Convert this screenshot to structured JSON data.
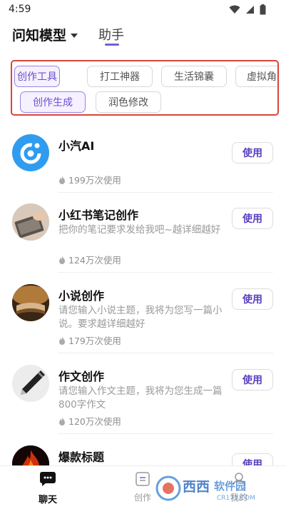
{
  "status_bar": {
    "time": "4:59"
  },
  "header": {
    "model_title": "问知模型",
    "tab_assistant": "助手"
  },
  "categories": {
    "row1": [
      "创作工具",
      "打工神器",
      "生活锦囊",
      "虚拟角"
    ],
    "row2": [
      "创作生成",
      "润色修改"
    ]
  },
  "items": [
    {
      "title": "小汽AI",
      "desc": "",
      "usage": "199万次使用",
      "button": "使用"
    },
    {
      "title": "小红书笔记创作",
      "desc": "把你的笔记要求发给我吧~越详细越好",
      "usage": "124万次使用",
      "button": "使用"
    },
    {
      "title": "小说创作",
      "desc": "请您输入小说主题，我将为您写一篇小说。要求越详细越好",
      "usage": "179万次使用",
      "button": "使用"
    },
    {
      "title": "作文创作",
      "desc": "请您输入作文主题，我将为您生成一篇800字作文",
      "usage": "120万次使用",
      "button": "使用"
    },
    {
      "title": "爆款标题",
      "desc": "",
      "usage": "",
      "button": "使用"
    }
  ],
  "bottom_nav": {
    "chat": "聊天",
    "create": "创作",
    "mine": "我的"
  },
  "watermark": {
    "text": "西西软件园",
    "sub": "CR173.COM"
  },
  "colors": {
    "accent": "#7b5cd6",
    "highlight_box": "#d9453a"
  }
}
